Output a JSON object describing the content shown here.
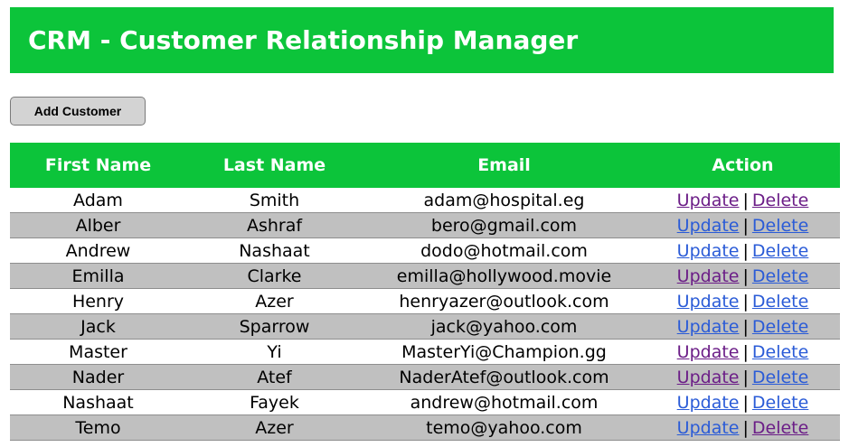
{
  "header": {
    "title": "CRM - Customer Relationship Manager"
  },
  "toolbar": {
    "add_label": "Add Customer"
  },
  "table": {
    "columns": [
      "First Name",
      "Last Name",
      "Email",
      "Action"
    ],
    "action_update_label": "Update",
    "action_delete_label": "Delete",
    "action_separator": "|",
    "rows": [
      {
        "first": "Adam",
        "last": "Smith",
        "email": "adam@hospital.eg"
      },
      {
        "first": "Alber",
        "last": "Ashraf",
        "email": "bero@gmail.com"
      },
      {
        "first": "Andrew",
        "last": "Nashaat",
        "email": "dodo@hotmail.com"
      },
      {
        "first": "Emilla",
        "last": "Clarke",
        "email": "emilla@hollywood.movie"
      },
      {
        "first": "Henry",
        "last": "Azer",
        "email": "henryazer@outlook.com"
      },
      {
        "first": "Jack",
        "last": "Sparrow",
        "email": "jack@yahoo.com"
      },
      {
        "first": "Master",
        "last": "Yi",
        "email": "MasterYi@Champion.gg"
      },
      {
        "first": "Nader",
        "last": "Atef",
        "email": "NaderAtef@outlook.com"
      },
      {
        "first": "Nashaat",
        "last": "Fayek",
        "email": "andrew@hotmail.com"
      },
      {
        "first": "Temo",
        "last": "Azer",
        "email": "temo@yahoo.com"
      }
    ]
  },
  "colors": {
    "brand_green": "#0cc43a",
    "row_alt": "#c0c0c0",
    "link": "#2a5bd7",
    "link_visited": "#6b1d87"
  }
}
